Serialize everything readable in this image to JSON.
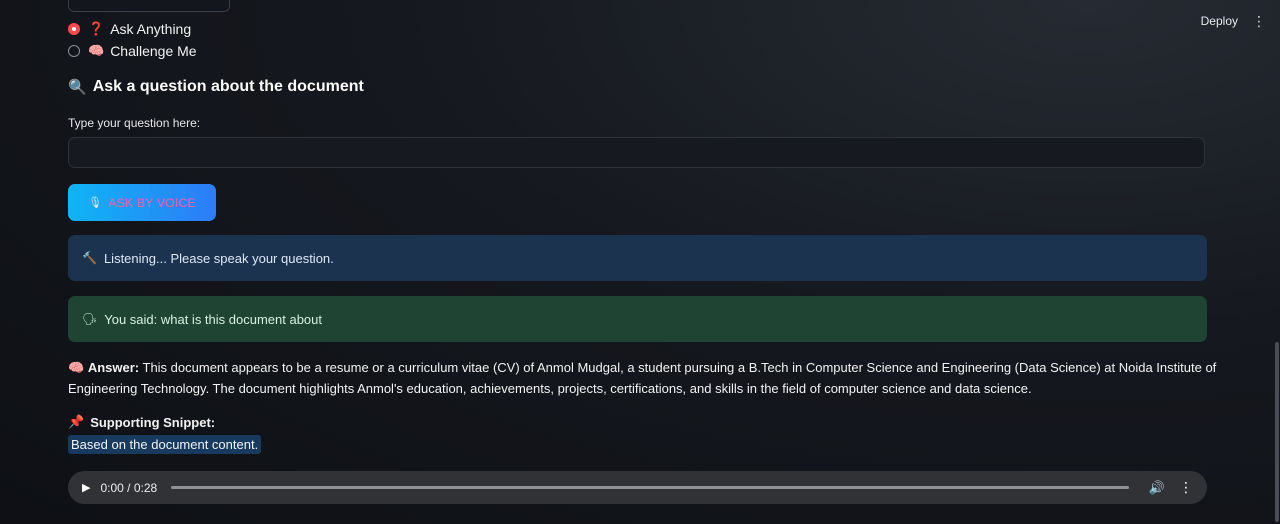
{
  "header": {
    "deploy_label": "Deploy",
    "menu_icon": "⋮"
  },
  "mode": {
    "selected": "ask",
    "options": [
      {
        "emoji": "❓",
        "label": "Ask Anything"
      },
      {
        "emoji": "🧠",
        "label": "Challenge Me"
      }
    ]
  },
  "ask_section": {
    "emoji": "🔍",
    "title": "Ask a question about the document",
    "input_label": "Type your question here:",
    "input_value": "",
    "voice_button": {
      "icon": "🎙",
      "label": "ASK BY VOICE"
    }
  },
  "alerts": {
    "listening": {
      "icon": "🔨",
      "text": "Listening... Please speak your question."
    },
    "transcript": {
      "icon": "🗣",
      "text": "You said: what is this document about"
    }
  },
  "answer": {
    "emoji": "🧠",
    "label": "Answer:",
    "text": "This document appears to be a resume or a curriculum vitae (CV) of Anmol Mudgal, a student pursuing a B.Tech in Computer Science and Engineering (Data Science) at Noida Institute of Engineering Technology. The document highlights Anmol's education, achievements, projects, certifications, and skills in the field of computer science and data science."
  },
  "snippet": {
    "emoji": "📌",
    "label": "Supporting Snippet:",
    "text": "Based on the document content."
  },
  "audio": {
    "time": "0:00 / 0:28",
    "progress": 0.0,
    "play_icon": "▶",
    "volume_icon": "🔊",
    "more_icon": "⋮"
  },
  "colors": {
    "accent": "#ff4b4b",
    "info_bg": "#1c3350",
    "success_bg": "#1f4433",
    "button_gradient_start": "#0fb4f5",
    "button_gradient_end": "#2e7cf6"
  }
}
